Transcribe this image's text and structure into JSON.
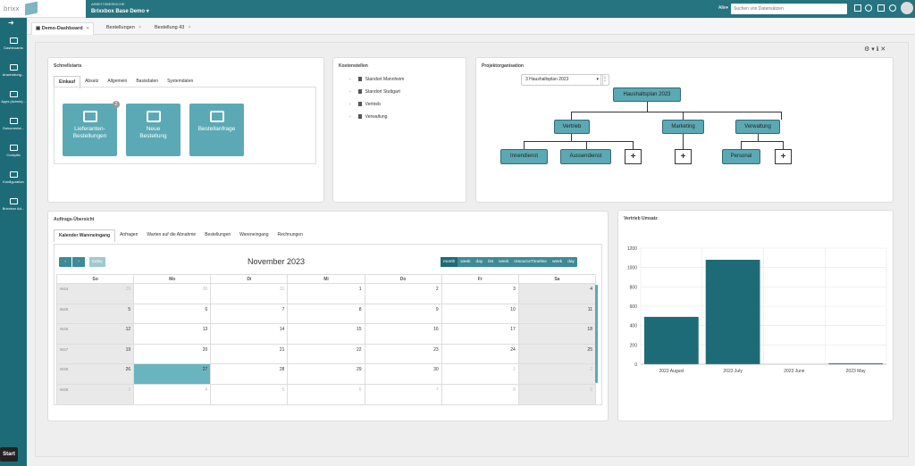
{
  "brand": {
    "logo_text": "brixx"
  },
  "topbar": {
    "workspace_caption": "ARBEITSBEREICHE",
    "workspace_value": "Brixxbox Base Demo",
    "search_scope": "Alle",
    "search_placeholder": "Suchen von Datensätzen"
  },
  "sidebar": {
    "items": [
      {
        "label": "Dashboards",
        "icon": "dashboard-icon"
      },
      {
        "label": "Anwendung...",
        "icon": "application-icon"
      },
      {
        "label": "Apps (Admin)...",
        "icon": "mobile-icon"
      },
      {
        "label": "Dokumenta...",
        "icon": "document-icon"
      },
      {
        "label": "Cockpits",
        "icon": "cogs-icon"
      },
      {
        "label": "Konfiguration",
        "icon": "cogs-icon"
      },
      {
        "label": "Brixxbox Ad...",
        "icon": "cogs-icon"
      }
    ],
    "start_label": "Start"
  },
  "tabs": [
    {
      "label": "Demo-Dashboard"
    },
    {
      "label": "Bestellungen"
    },
    {
      "label": "Bestellung 43"
    }
  ],
  "schnellstarts": {
    "title": "Schnellstarts",
    "tabs": [
      "Einkauf",
      "Absatz",
      "Allgemein",
      "Basisdaten",
      "Systemdaten"
    ],
    "tiles": [
      {
        "line1": "Lieferanten-",
        "line2": "Bestellungen",
        "badge": "2"
      },
      {
        "line1": "Neue",
        "line2": "Bestellung",
        "badge": ""
      },
      {
        "line1": "Bestellanfrage",
        "line2": "",
        "badge": ""
      }
    ]
  },
  "kostenstellen": {
    "title": "Kostenstellen",
    "items": [
      "Standort Mannheim",
      "Standort Stuttgart",
      "Vertrieb",
      "Verwaltung"
    ]
  },
  "projektorganisation": {
    "title": "Projektorganisation",
    "select_value": "3 Haushaltsplan 2023",
    "root": "Haushaltsplan 2023",
    "level1": [
      "Vertrieb",
      "Marketing",
      "Verwaltung"
    ],
    "level2": [
      "Innendienst",
      "Aussendienst",
      "Personal"
    ],
    "plus": "+"
  },
  "auftrage": {
    "title": "Auftrags-Übersicht",
    "tabs": [
      "Kalender Wareneingang",
      "Anfragen",
      "Warten auf die Abnahme",
      "Bestellungen",
      "Wareneingang",
      "Rechnungen"
    ],
    "calendar": {
      "month_title": "November 2023",
      "prev": "‹",
      "next": "›",
      "today": "today",
      "views": [
        "month",
        "week",
        "day",
        "list",
        "week",
        "resourceTimeline",
        "week",
        "day"
      ],
      "weekdays": [
        "So",
        "Mo",
        "Di",
        "Mi",
        "Do",
        "Fr",
        "Sa"
      ],
      "weeks": [
        {
          "wk": "W44",
          "days": [
            "29",
            "30",
            "31",
            "1",
            "2",
            "3",
            "4"
          ]
        },
        {
          "wk": "W45",
          "days": [
            "5",
            "6",
            "7",
            "8",
            "9",
            "10",
            "11"
          ]
        },
        {
          "wk": "W46",
          "days": [
            "12",
            "13",
            "14",
            "15",
            "16",
            "17",
            "18"
          ]
        },
        {
          "wk": "W47",
          "days": [
            "19",
            "20",
            "21",
            "22",
            "23",
            "24",
            "25"
          ]
        },
        {
          "wk": "W48",
          "days": [
            "26",
            "27",
            "28",
            "29",
            "30",
            "1",
            "2"
          ]
        },
        {
          "wk": "W49",
          "days": [
            "3",
            "4",
            "5",
            "6",
            "7",
            "8",
            "9"
          ]
        }
      ],
      "highlight_day": "27"
    }
  },
  "vertrieb": {
    "title": "Vertrieb Umsatz"
  },
  "chart_data": {
    "type": "bar",
    "categories": [
      "2023 August",
      "2023 July",
      "2023 June",
      "2023 May"
    ],
    "values": [
      490,
      1080,
      0,
      10
    ],
    "ylim": [
      0,
      1200
    ],
    "yticks": [
      0,
      200,
      400,
      600,
      800,
      1000,
      1200
    ],
    "grid": true,
    "color": "#1e6b78"
  },
  "colors": {
    "accent": "#26747f",
    "tile": "#5ba9b5",
    "sidebar": "#1e6b78"
  }
}
